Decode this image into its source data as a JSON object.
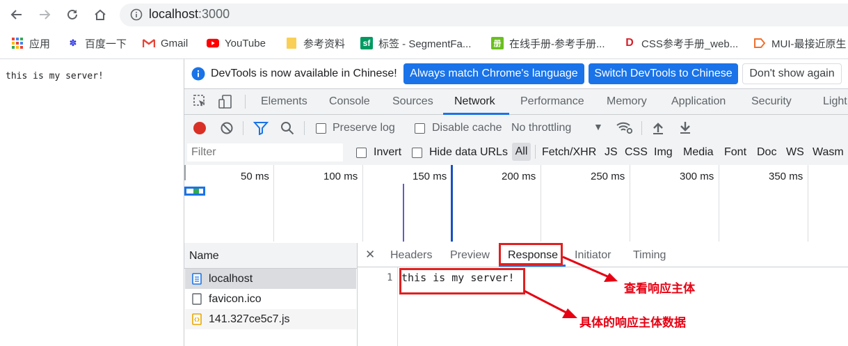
{
  "browser": {
    "address": "localhost:3000",
    "address_host": "localhost",
    "address_port": ":3000",
    "bookmarks": [
      {
        "label": "应用",
        "icon": "apps-grid-icon"
      },
      {
        "label": "百度一下",
        "icon": "baidu-paw-icon"
      },
      {
        "label": "Gmail",
        "icon": "gmail-icon"
      },
      {
        "label": "YouTube",
        "icon": "youtube-icon"
      },
      {
        "label": "参考资料",
        "icon": "folder-icon"
      },
      {
        "label": "标签 - SegmentFa...",
        "icon": "segmentfault-icon"
      },
      {
        "label": "在线手册-参考手册...",
        "icon": "manual-icon"
      },
      {
        "label": "CSS参考手册_web...",
        "icon": "css-manual-icon"
      },
      {
        "label": "MUI-最接近原生",
        "icon": "mui-icon"
      }
    ]
  },
  "page": {
    "body_text": "this is my server!"
  },
  "devtools": {
    "infobar": {
      "message": "DevTools is now available in Chinese!",
      "btn_match": "Always match Chrome's language",
      "btn_switch": "Switch DevTools to Chinese",
      "btn_dismiss": "Don't show again"
    },
    "tabs": [
      "Elements",
      "Console",
      "Sources",
      "Network",
      "Performance",
      "Memory",
      "Application",
      "Security",
      "Light"
    ],
    "active_tab": "Network",
    "network": {
      "preserve_log": "Preserve log",
      "disable_cache": "Disable cache",
      "throttling": "No throttling",
      "filter_placeholder": "Filter",
      "invert": "Invert",
      "hide_data_urls": "Hide data URLs",
      "type_filters": [
        "All",
        "Fetch/XHR",
        "JS",
        "CSS",
        "Img",
        "Media",
        "Font",
        "Doc",
        "WS",
        "Wasm"
      ],
      "timeline_ticks": [
        "50 ms",
        "100 ms",
        "150 ms",
        "200 ms",
        "250 ms",
        "300 ms",
        "350 ms"
      ],
      "name_header": "Name",
      "requests": [
        {
          "name": "localhost",
          "icon": "document-icon",
          "selected": true
        },
        {
          "name": "favicon.ico",
          "icon": "file-icon",
          "selected": false
        },
        {
          "name": "141.327ce5c7.js",
          "icon": "script-icon",
          "selected": false
        }
      ],
      "detail_tabs": [
        "Headers",
        "Preview",
        "Response",
        "Initiator",
        "Timing"
      ],
      "active_detail_tab": "Response",
      "response": {
        "line_number": "1",
        "line_text": "this is my server!"
      }
    }
  },
  "annotations": {
    "response_tab_note": "查看响应主体",
    "response_body_note": "具体的响应主体数据",
    "color": "#e60012"
  },
  "colors": {
    "accent_blue": "#1a73e8",
    "record_red": "#d93025",
    "annotation_red": "#e60012"
  }
}
